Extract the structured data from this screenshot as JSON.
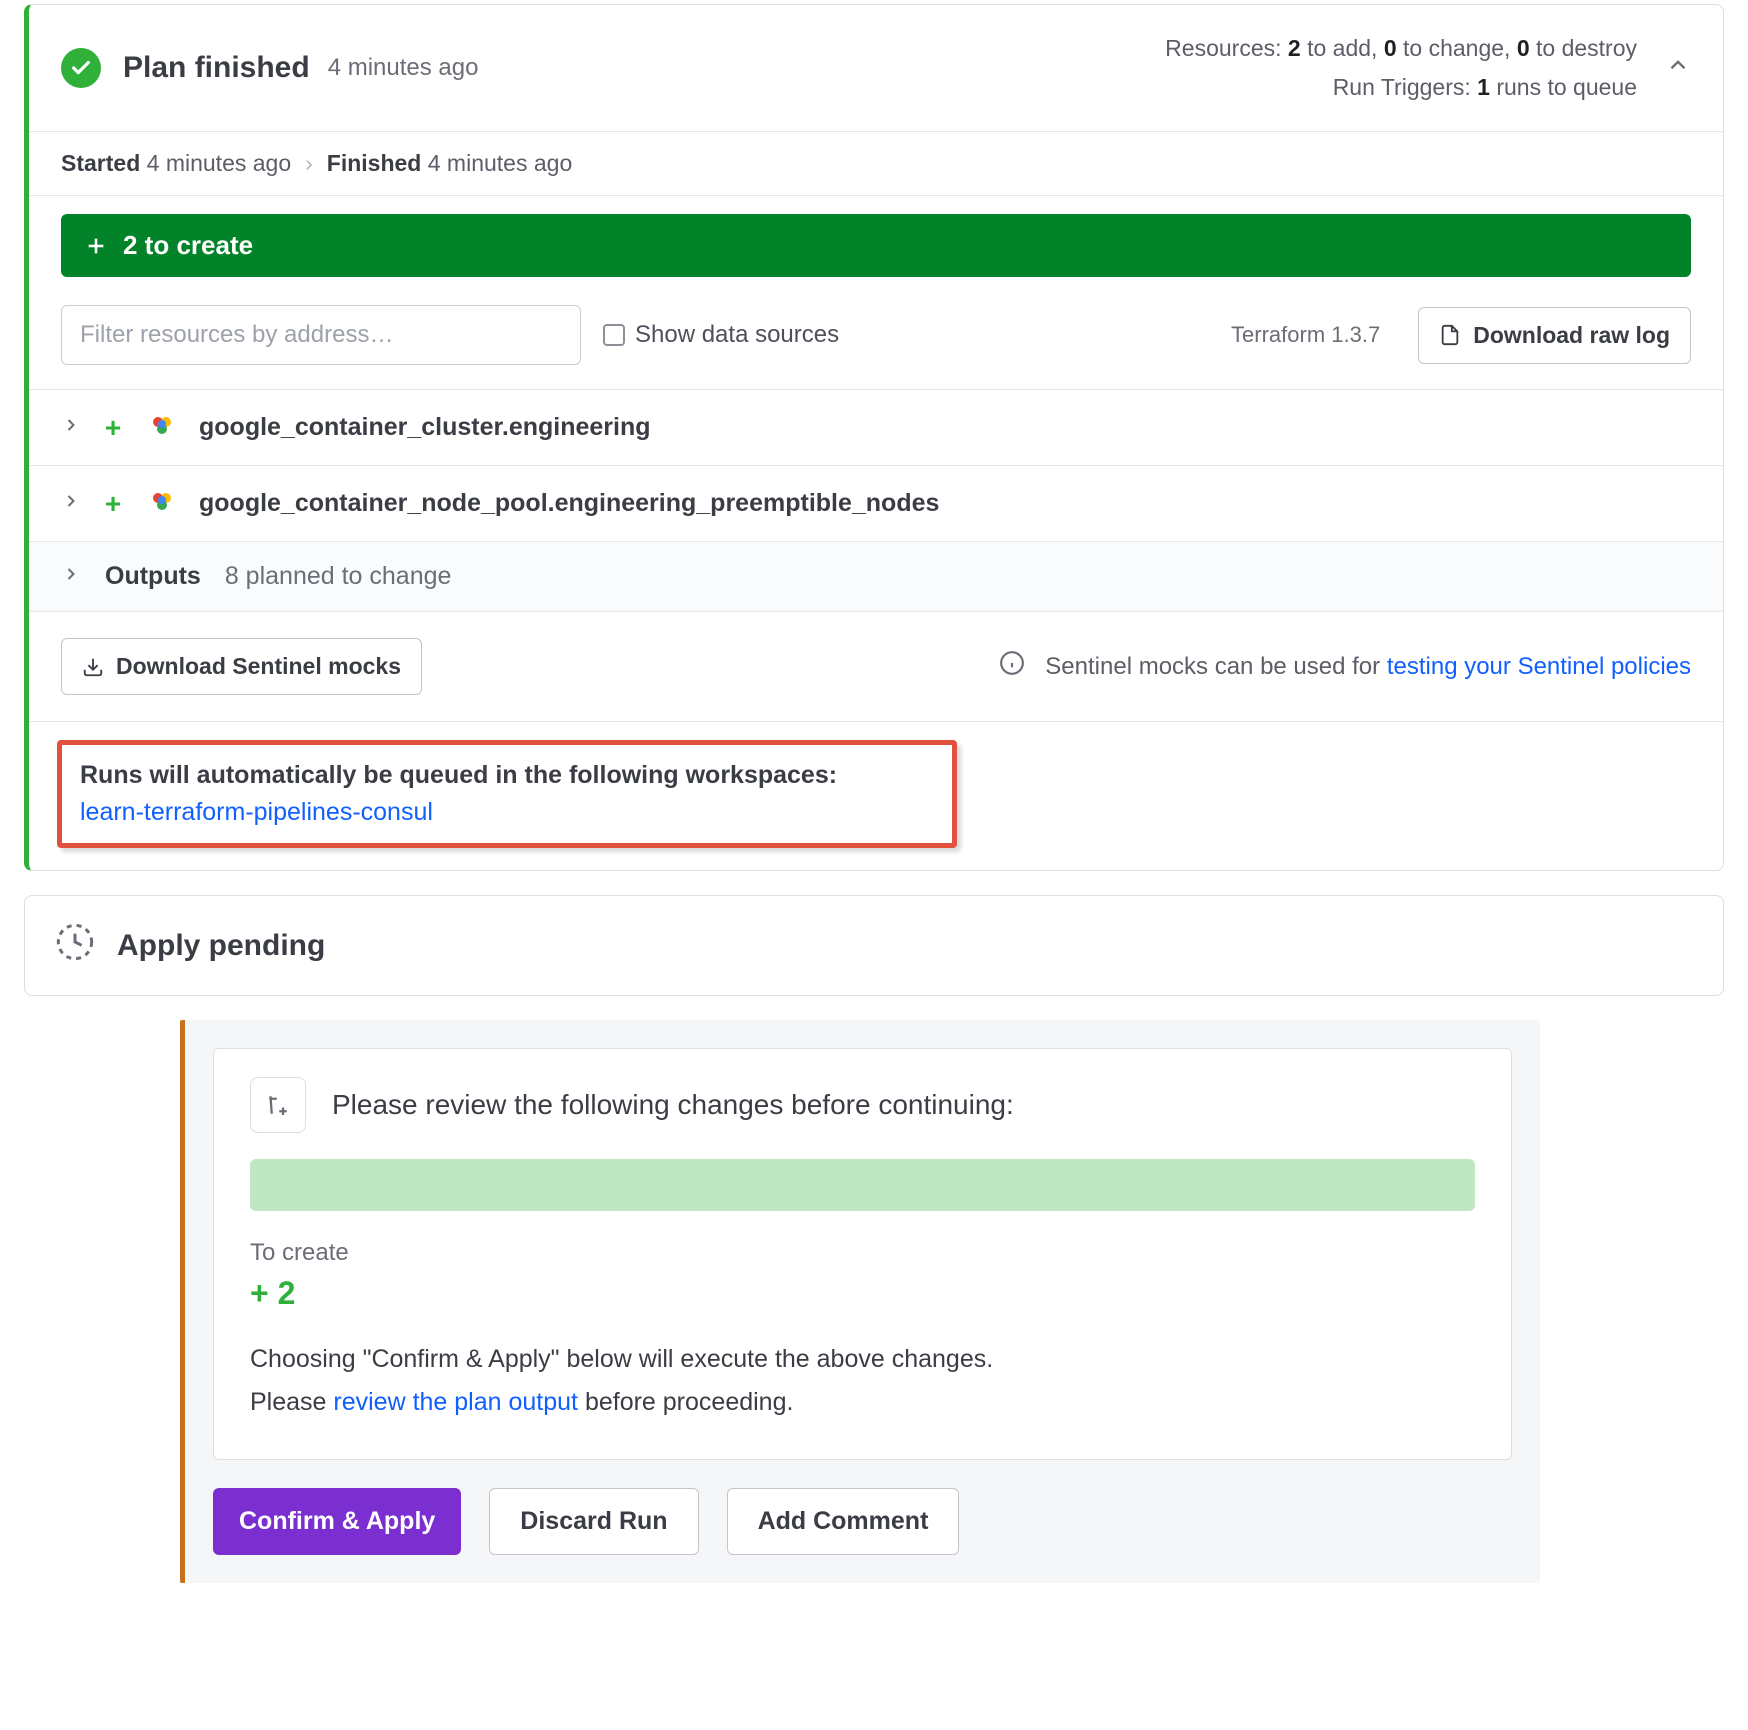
{
  "plan": {
    "title": "Plan finished",
    "subtitle": "4 minutes ago",
    "resources_label_prefix": "Resources: ",
    "to_add": "2",
    "to_add_suffix": " to add, ",
    "to_change": "0",
    "to_change_suffix": " to change, ",
    "to_destroy": "0",
    "to_destroy_suffix": " to destroy",
    "run_triggers_prefix": "Run Triggers: ",
    "runs_to_queue": "1",
    "runs_to_queue_suffix": " runs to queue",
    "started_label": "Started",
    "started_time": " 4 minutes ago",
    "finished_label": "Finished",
    "finished_time": " 4 minutes ago",
    "create_bar": "2 to create",
    "filter_placeholder": "Filter resources by address…",
    "show_data_sources": "Show data sources",
    "tf_version": "Terraform 1.3.7",
    "download_raw_log": "Download raw log",
    "resources": [
      {
        "name": "google_container_cluster.engineering"
      },
      {
        "name": "google_container_node_pool.engineering_preemptible_nodes"
      }
    ],
    "outputs_label": "Outputs",
    "outputs_sub": "8 planned to change",
    "download_sentinel": "Download Sentinel mocks",
    "sentinel_text_prefix": "Sentinel mocks can be used for ",
    "sentinel_link": "testing your Sentinel policies",
    "highlight_title": "Runs will automatically be queued in the following workspaces:",
    "highlight_link": "learn-terraform-pipelines-consul"
  },
  "apply_pending": "Apply pending",
  "review": {
    "title": "Please review the following changes before continuing:",
    "to_create_label": "To create",
    "plus2": "+ 2",
    "body_line1": "Choosing \"Confirm & Apply\" below will execute the above changes.",
    "body_line2_prefix": "Please ",
    "body_line2_link": "review the plan output",
    "body_line2_suffix": " before proceeding.",
    "confirm": "Confirm & Apply",
    "discard": "Discard Run",
    "add_comment": "Add Comment",
    "tf_symbol": "⁺⁄₊"
  }
}
